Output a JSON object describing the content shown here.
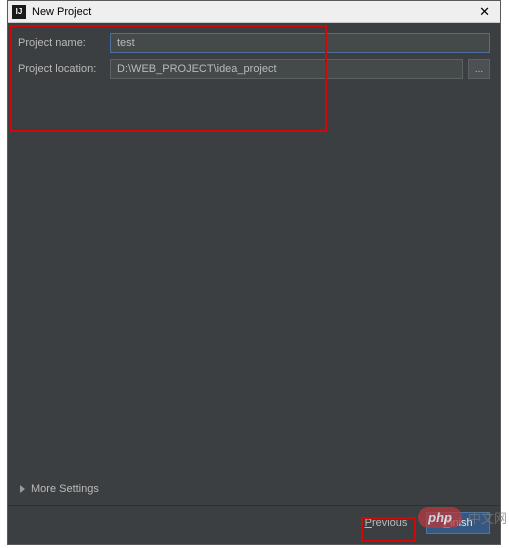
{
  "window": {
    "title": "New Project",
    "icon_text": "IJ",
    "close_glyph": "✕"
  },
  "form": {
    "name_label": "Project name:",
    "name_value": "test",
    "location_label": "Project location:",
    "location_value": "D:\\WEB_PROJECT\\idea_project",
    "browse_label": "..."
  },
  "more_settings_label": "More Settings",
  "buttons": {
    "previous": "Previous",
    "previous_ul": "P",
    "previous_rest": "revious",
    "finish": "Finish",
    "finish_ul": "F",
    "finish_rest": "inish"
  },
  "watermark": {
    "pill": "php",
    "text": "中文网"
  }
}
